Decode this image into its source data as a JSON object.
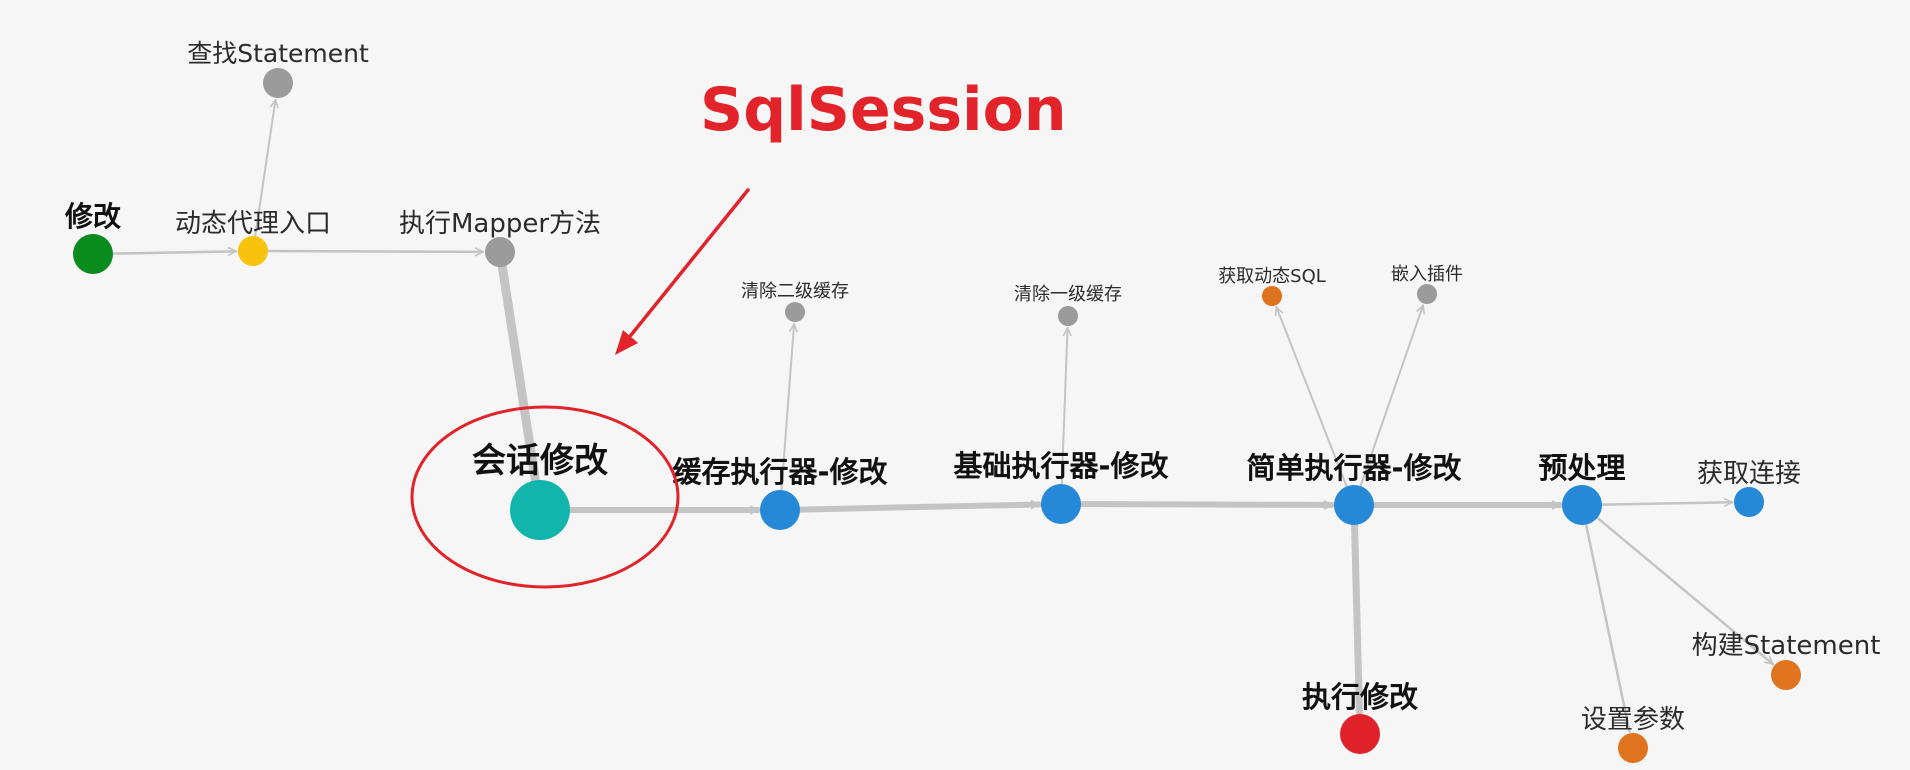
{
  "annotation": {
    "title": "SqlSession"
  },
  "colors": {
    "background": "#f6f6f6",
    "edge": "#c4c4c4",
    "arrow": "#c4c4c4",
    "annotation": "#e2232a",
    "green": "#0a8b1e",
    "yellow": "#f9c30d",
    "gray": "#9b9b9b",
    "teal": "#12b5ac",
    "blue": "#2589d8",
    "orange": "#e0731e",
    "red": "#e0232b"
  },
  "nodes": [
    {
      "id": "modify",
      "label": "修改",
      "color": "green",
      "bold": true
    },
    {
      "id": "proxy_entry",
      "label": "动态代理入口",
      "color": "yellow",
      "bold": false
    },
    {
      "id": "find_statement",
      "label": "查找Statement",
      "color": "gray",
      "bold": false
    },
    {
      "id": "exec_mapper",
      "label": "执行Mapper方法",
      "color": "gray",
      "bold": false
    },
    {
      "id": "session_modify",
      "label": "会话修改",
      "color": "teal",
      "bold": true
    },
    {
      "id": "cache_exec",
      "label": "缓存执行器-修改",
      "color": "blue",
      "bold": true
    },
    {
      "id": "clear_l2",
      "label": "清除二级缓存",
      "color": "gray",
      "bold": false
    },
    {
      "id": "base_exec",
      "label": "基础执行器-修改",
      "color": "blue",
      "bold": true
    },
    {
      "id": "clear_l1",
      "label": "清除一级缓存",
      "color": "gray",
      "bold": false
    },
    {
      "id": "simple_exec",
      "label": "简单执行器-修改",
      "color": "blue",
      "bold": true
    },
    {
      "id": "dyn_sql",
      "label": "获取动态SQL",
      "color": "orange",
      "bold": false
    },
    {
      "id": "plugin",
      "label": "嵌入插件",
      "color": "gray",
      "bold": false
    },
    {
      "id": "exec_modify",
      "label": "执行修改",
      "color": "red",
      "bold": true
    },
    {
      "id": "preprocess",
      "label": "预处理",
      "color": "blue",
      "bold": true
    },
    {
      "id": "get_conn",
      "label": "获取连接",
      "color": "blue",
      "bold": false
    },
    {
      "id": "build_statement",
      "label": "构建Statement",
      "color": "orange",
      "bold": false
    },
    {
      "id": "set_params",
      "label": "设置参数",
      "color": "orange",
      "bold": false
    }
  ],
  "edges": [
    {
      "from": "modify",
      "to": "proxy_entry"
    },
    {
      "from": "proxy_entry",
      "to": "find_statement"
    },
    {
      "from": "proxy_entry",
      "to": "exec_mapper"
    },
    {
      "from": "exec_mapper",
      "to": "session_modify"
    },
    {
      "from": "session_modify",
      "to": "cache_exec"
    },
    {
      "from": "cache_exec",
      "to": "clear_l2"
    },
    {
      "from": "cache_exec",
      "to": "base_exec"
    },
    {
      "from": "base_exec",
      "to": "clear_l1"
    },
    {
      "from": "base_exec",
      "to": "simple_exec"
    },
    {
      "from": "simple_exec",
      "to": "dyn_sql"
    },
    {
      "from": "simple_exec",
      "to": "plugin"
    },
    {
      "from": "simple_exec",
      "to": "exec_modify"
    },
    {
      "from": "simple_exec",
      "to": "preprocess"
    },
    {
      "from": "preprocess",
      "to": "get_conn"
    },
    {
      "from": "preprocess",
      "to": "build_statement"
    },
    {
      "from": "preprocess",
      "to": "set_params"
    }
  ]
}
